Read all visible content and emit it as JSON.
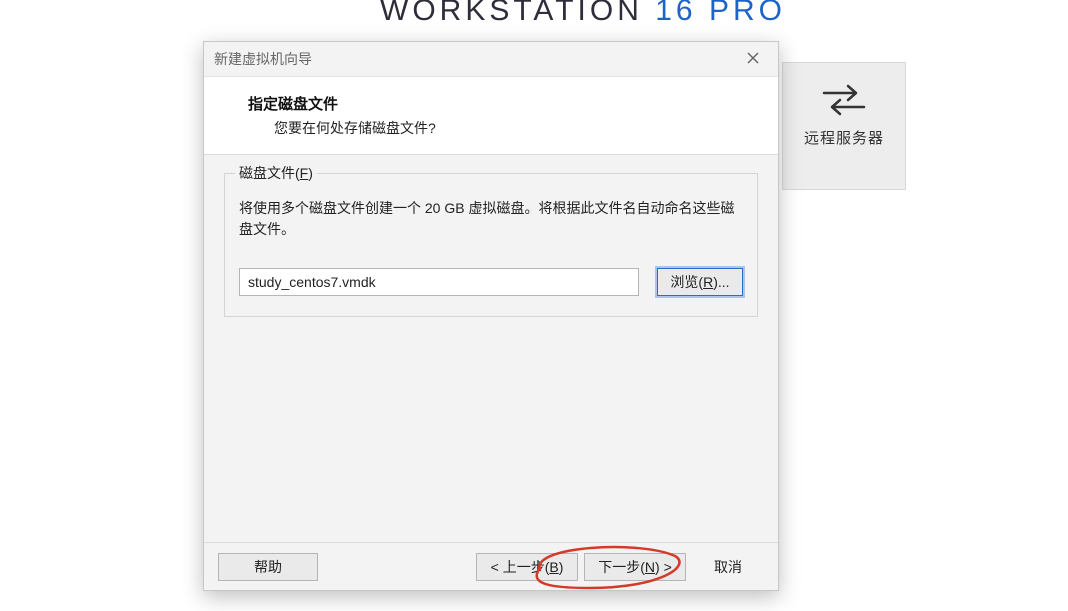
{
  "brand": {
    "word1": "WORKSTATION",
    "word2": "16",
    "word3": "PRO"
  },
  "remoteCard": {
    "label": "远程服务器"
  },
  "dialog": {
    "title": "新建虚拟机向导",
    "header": {
      "title": "指定磁盘文件",
      "subtitle": "您要在何处存储磁盘文件?"
    },
    "group": {
      "legend_prefix": "磁盘文件(",
      "legend_key": "F",
      "legend_suffix": ")",
      "description": "将使用多个磁盘文件创建一个 20 GB 虚拟磁盘。将根据此文件名自动命名这些磁盘文件。",
      "file_value": "study_centos7.vmdk",
      "browse_prefix": "浏览(",
      "browse_key": "R",
      "browse_suffix": ")..."
    },
    "buttons": {
      "help": "帮助",
      "back_prefix": "< 上一步(",
      "back_key": "B",
      "back_suffix": ")",
      "next_prefix": "下一步(",
      "next_key": "N",
      "next_suffix": ") >",
      "cancel": "取消"
    }
  }
}
